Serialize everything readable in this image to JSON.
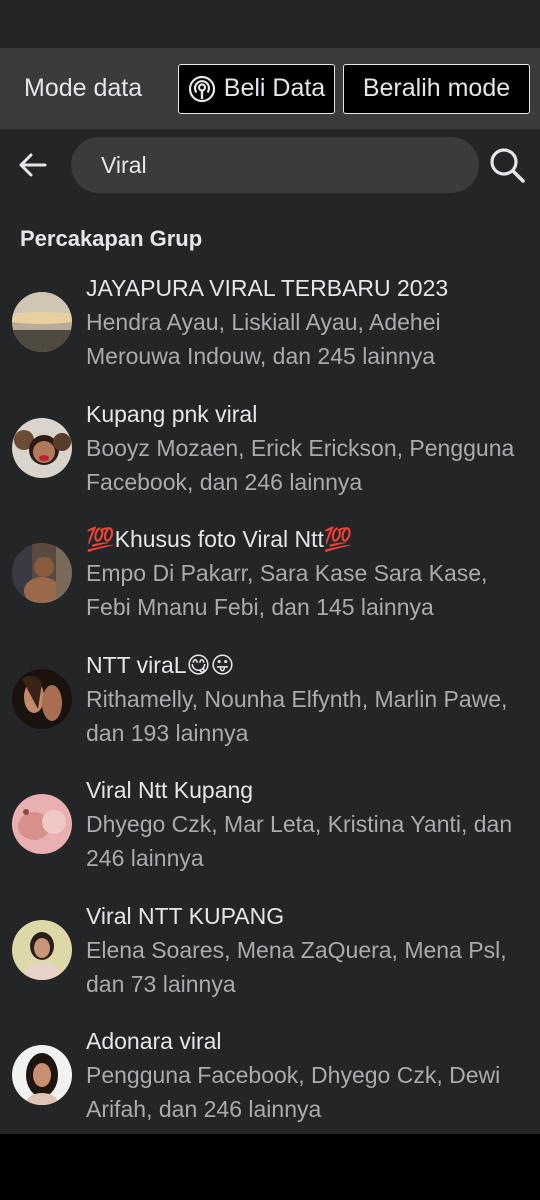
{
  "data_mode": {
    "label": "Mode data",
    "buy_label": "Beli Data",
    "switch_label": "Beralih mode"
  },
  "search": {
    "value": "Viral"
  },
  "section": {
    "title": "Percakapan Grup"
  },
  "results": [
    {
      "title": "JAYAPURA VIRAL TERBARU 2023",
      "members": "Hendra Ayau, Liskiall Ayau, Adehei Merouwa Indouw, dan 245 lainnya"
    },
    {
      "title": "Kupang pnk viral",
      "members": "Booyz Mozaen, Erick Erickson, Pengguna Facebook, dan 246 lainnya"
    },
    {
      "title": "💯Khusus foto Viral Ntt💯",
      "members": "Empo Di Pakarr, Sara Kase Sara Kase, Febi Mnanu Febi, dan 145 lainnya"
    },
    {
      "title": "NTT viraL😋😛",
      "members": "Rithamelly, Nounha Elfynth, Marlin Pawe, dan 193 lainnya"
    },
    {
      "title": "Viral Ntt Kupang",
      "members": "Dhyego Czk, Mar Leta, Kristina Yanti, dan 246 lainnya"
    },
    {
      "title": "Viral NTT KUPANG",
      "members": "Elena Soares, Mena ZaQuera, Mena Psl, dan 73 lainnya"
    },
    {
      "title": "Adonara viral",
      "members": "Pengguna Facebook, Dhyego Czk, Dewi Arifah, dan 246 lainnya"
    }
  ],
  "colors": {
    "background": "#242526",
    "bar": "#3a3b3c",
    "text_primary": "#e4e6eb",
    "text_secondary": "#a8abaf"
  }
}
